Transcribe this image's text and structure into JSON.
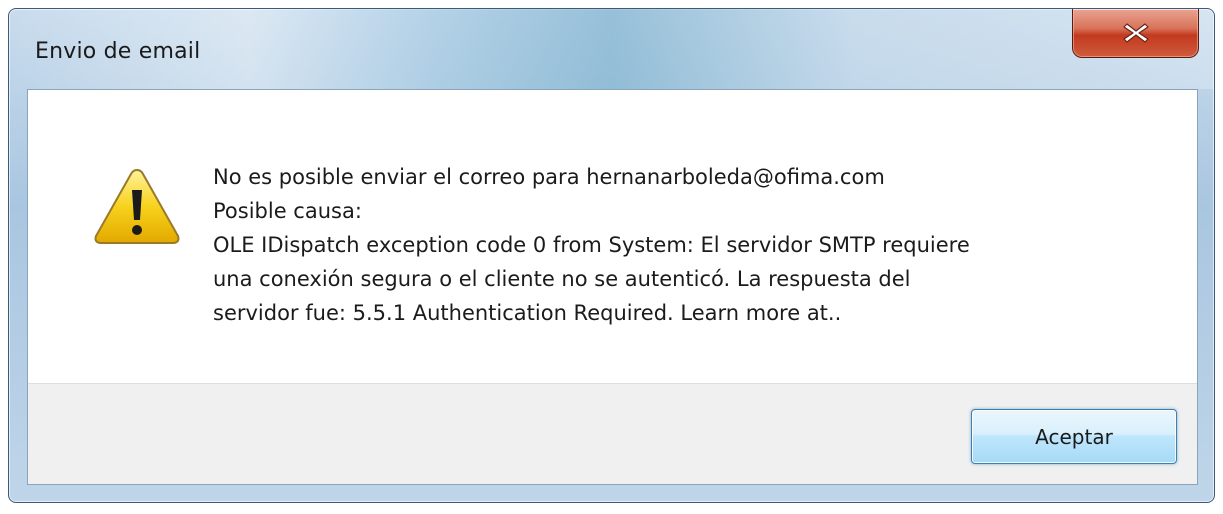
{
  "window": {
    "title": "Envio de email",
    "close_icon": "close-icon"
  },
  "message": {
    "icon": "warning-icon",
    "line1": "No es posible enviar el correo para hernanarboleda@ofima.com",
    "line2": "Posible causa:",
    "line3": "OLE IDispatch exception code 0 from System: El servidor SMTP requiere",
    "line4": "una conexión segura o el cliente no se autenticó. La respuesta del",
    "line5": "servidor fue: 5.5.1 Authentication Required. Learn more at.."
  },
  "buttons": {
    "ok_label": "Aceptar"
  },
  "colors": {
    "close_button": "#c23a1f",
    "ok_border": "#3c7fb1",
    "warning_yellow": "#f5c400"
  }
}
